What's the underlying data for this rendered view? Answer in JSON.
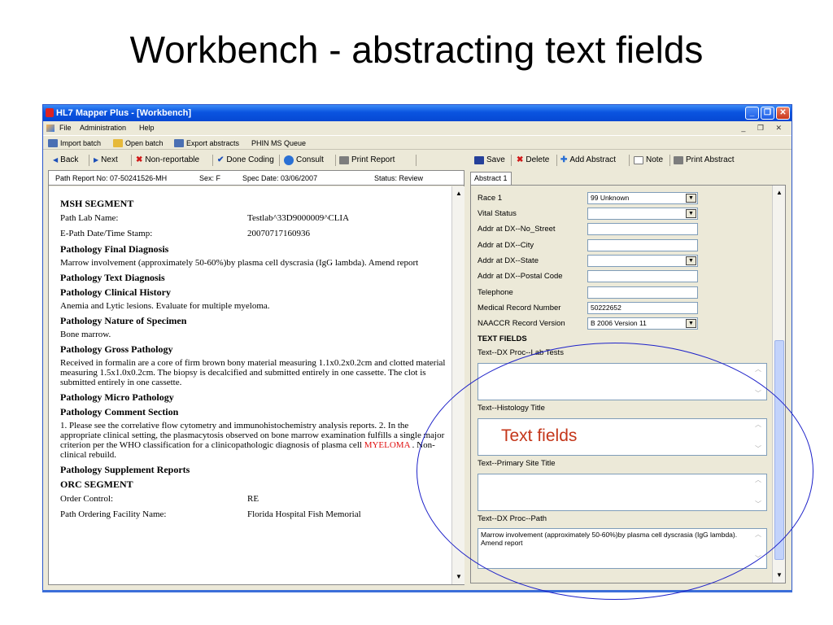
{
  "slide": {
    "title": "Workbench - abstracting text fields",
    "callout": "Text fields"
  },
  "window": {
    "title": "HL7 Mapper Plus - [Workbench]",
    "min": "_",
    "max": "❐",
    "close": "✕"
  },
  "menu": {
    "items": [
      "File",
      "Administration",
      "Help"
    ],
    "mdi_controls": "_ ❐ ✕"
  },
  "toolbar1": {
    "import": "Import batch",
    "open": "Open batch",
    "export": "Export abstracts",
    "queue": "PHIN MS Queue"
  },
  "toolbar2": {
    "back": "Back",
    "next": "Next",
    "nonreportable": "Non-reportable",
    "done": "Done Coding",
    "consult": "Consult",
    "print_report": "Print Report",
    "save": "Save",
    "delete": "Delete",
    "add_abstract": "Add Abstract",
    "note": "Note",
    "print_abstract": "Print Abstract"
  },
  "path_header": {
    "report_no": "Path Report No:   07-50241526-MH",
    "sex": "Sex:  F",
    "spec_date": "Spec Date:   03/06/2007",
    "status": "Status:  Review"
  },
  "report": {
    "msh": "MSH SEGMENT",
    "lab_name_k": "Path Lab Name:",
    "lab_name_v": "Testlab^33D9000009^CLIA",
    "stamp_k": "E-Path Date/Time Stamp:",
    "stamp_v": "20070717160936",
    "final_dx_h": "Pathology Final Diagnosis",
    "final_dx": "Marrow involvement (approximately 50-60%)by plasma cell dyscrasia (IgG lambda). Amend report",
    "text_dx_h": "Pathology Text Diagnosis",
    "clin_hist_h": "Pathology Clinical History",
    "clin_hist": "Anemia and Lytic lesions. Evaluate for multiple myeloma.",
    "nature_h": "Pathology Nature of Specimen",
    "nature": "Bone marrow.",
    "gross_h": "Pathology Gross Pathology",
    "gross": "Received in formalin are a core of firm brown bony material measuring 1.1x0.2x0.2cm and clotted material measuring 1.5x1.0x0.2cm. The biopsy is decalcified and submitted entirely in one cassette. The clot is submitted entirely in one cassette.",
    "micro_h": "Pathology Micro Pathology",
    "comment_h": "Pathology Comment Section",
    "comment_a": "1. Please see the correlative flow cytometry and immunohistochemistry analysis reports. 2. In the appropriate clinical setting, the plasmacytosis observed on bone marrow examination fulfills a single major criterion per the WHO classification for a clinicopathologic diagnosis of plasma cell ",
    "comment_red": "MYELOMA",
    "comment_b": " . Non-clinical rebuild.",
    "supp_h": "Pathology Supplement Reports",
    "orc": "ORC SEGMENT",
    "order_k": "Order Control:",
    "order_v": "RE",
    "facility_k": "Path Ordering Facility Name:",
    "facility_v": "Florida Hospital Fish Memorial"
  },
  "abstract": {
    "tab": "Abstract 1",
    "race_label": "Race 1",
    "race_value": "99  Unknown",
    "vital_label": "Vital Status",
    "street_label": "Addr at DX--No_Street",
    "city_label": "Addr at DX--City",
    "state_label": "Addr at DX--State",
    "postal_label": "Addr at DX--Postal Code",
    "phone_label": "Telephone",
    "mrn_label": "Medical Record Number",
    "mrn_value": "50222652",
    "naaccr_label": "NAACCR Record Version",
    "naaccr_value": "B  2006 Version 11",
    "text_fields": "TEXT FIELDS",
    "lab_tests_label": "Text--DX Proc--Lab Tests",
    "histology_label": "Text--Histology Title",
    "primary_site_label": "Text--Primary Site Title",
    "dx_path_label": "Text--DX Proc--Path",
    "dx_path_value": "Marrow involvement (approximately 50-60%)by plasma cell dyscrasia (IgG lambda). Amend report"
  },
  "colors": {
    "accent": "#0a54e0",
    "highlight": "#e01010",
    "callout": "#c4361a",
    "ellipse": "#1e22c9"
  }
}
